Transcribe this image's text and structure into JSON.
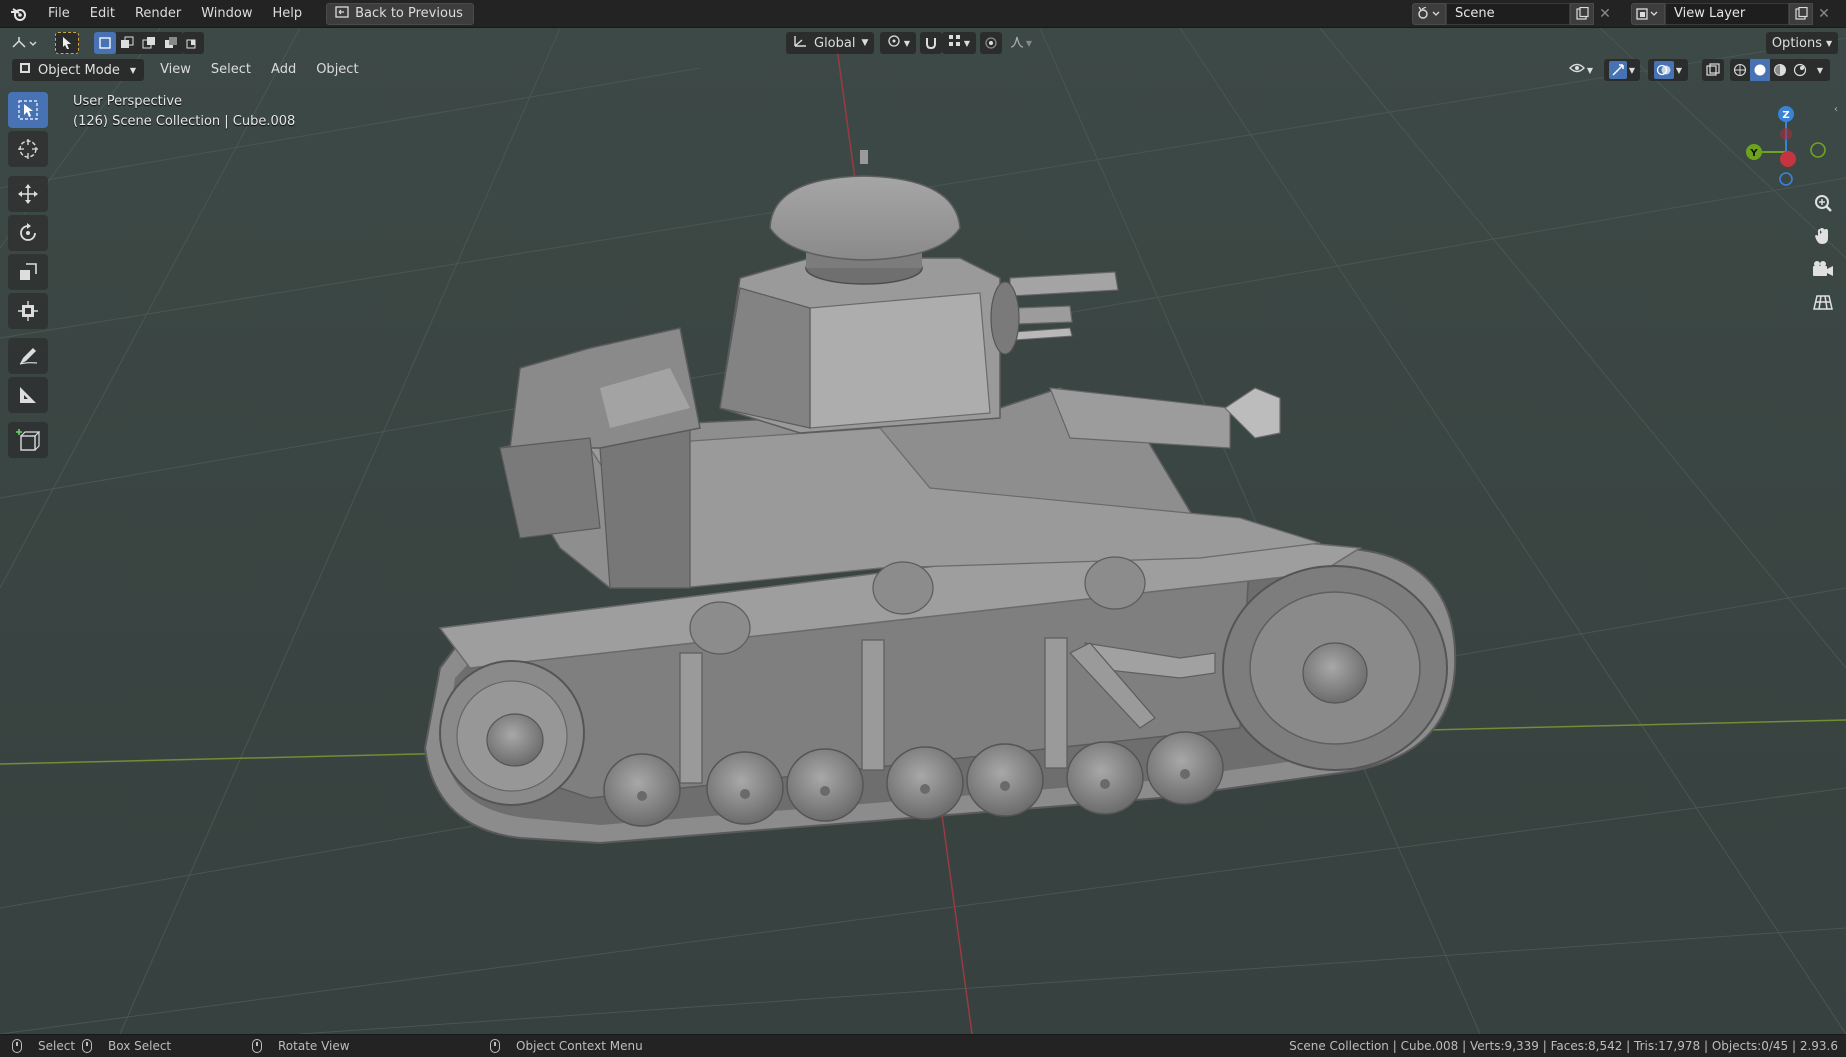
{
  "menu": {
    "items": [
      "File",
      "Edit",
      "Render",
      "Window",
      "Help"
    ],
    "back_button": "Back to Previous"
  },
  "scene": {
    "label": "Scene"
  },
  "view_layer": {
    "label": "View Layer"
  },
  "header": {
    "transform_orientation": "Global",
    "options_label": "Options",
    "mode": "Object Mode",
    "menus": [
      "View",
      "Select",
      "Add",
      "Object"
    ]
  },
  "viewport": {
    "perspective": "User Perspective",
    "collection_info": "(126) Scene Collection | Cube.008"
  },
  "gizmo": {
    "z": "Z",
    "y": "Y"
  },
  "toolbar": {
    "tools": [
      "select-box",
      "cursor",
      "move",
      "rotate",
      "scale",
      "transform",
      "annotate",
      "measure",
      "add-cube"
    ]
  },
  "status": {
    "select": "Select",
    "box_select": "Box Select",
    "rotate_view": "Rotate View",
    "context_menu": "Object Context Menu",
    "stats": "Scene Collection | Cube.008 | Verts:9,339 | Faces:8,542 | Tris:17,978 | Objects:0/45 | 2.93.6"
  },
  "colors": {
    "accent": "#4772b3",
    "viewport_bg": "#3b4744",
    "axis_x": "#c5353f",
    "axis_y": "#6ea31f",
    "axis_z": "#3a83d6"
  }
}
